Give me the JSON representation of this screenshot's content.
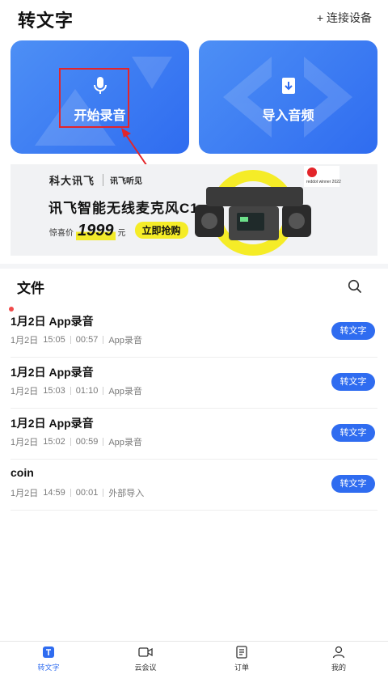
{
  "header": {
    "title": "转文字",
    "connect_label": "连接设备"
  },
  "actions": {
    "record_label": "开始录音",
    "import_label": "导入音频"
  },
  "banner": {
    "brand_main": "科大讯飞",
    "brand_sub": "讯飞听见",
    "headline": "讯飞智能无线麦克风C1",
    "price_label": "惊喜价",
    "price": "1999",
    "price_unit": "元",
    "buy_label": "立即抢购",
    "award_text": "reddot winner 2022"
  },
  "files": {
    "title": "文件",
    "items": [
      {
        "name": "1月2日 App录音",
        "date": "1月2日",
        "time": "15:05",
        "duration": "00:57",
        "source": "App录音",
        "action": "转文字",
        "unread": true
      },
      {
        "name": "1月2日 App录音",
        "date": "1月2日",
        "time": "15:03",
        "duration": "01:10",
        "source": "App录音",
        "action": "转文字",
        "unread": false
      },
      {
        "name": "1月2日 App录音",
        "date": "1月2日",
        "time": "15:02",
        "duration": "00:59",
        "source": "App录音",
        "action": "转文字",
        "unread": false
      },
      {
        "name": "coin",
        "date": "1月2日",
        "time": "14:59",
        "duration": "00:01",
        "source": "外部导入",
        "action": "转文字",
        "unread": false
      }
    ]
  },
  "tabs": [
    {
      "label": "转文字",
      "icon": "transcribe-icon",
      "active": true
    },
    {
      "label": "云会议",
      "icon": "video-meeting-icon",
      "active": false
    },
    {
      "label": "订单",
      "icon": "order-icon",
      "active": false
    },
    {
      "label": "我的",
      "icon": "profile-icon",
      "active": false
    }
  ],
  "colors": {
    "accent": "#2f6cf0",
    "annotation": "#e3252a",
    "promo_yellow": "#f5ec27"
  }
}
